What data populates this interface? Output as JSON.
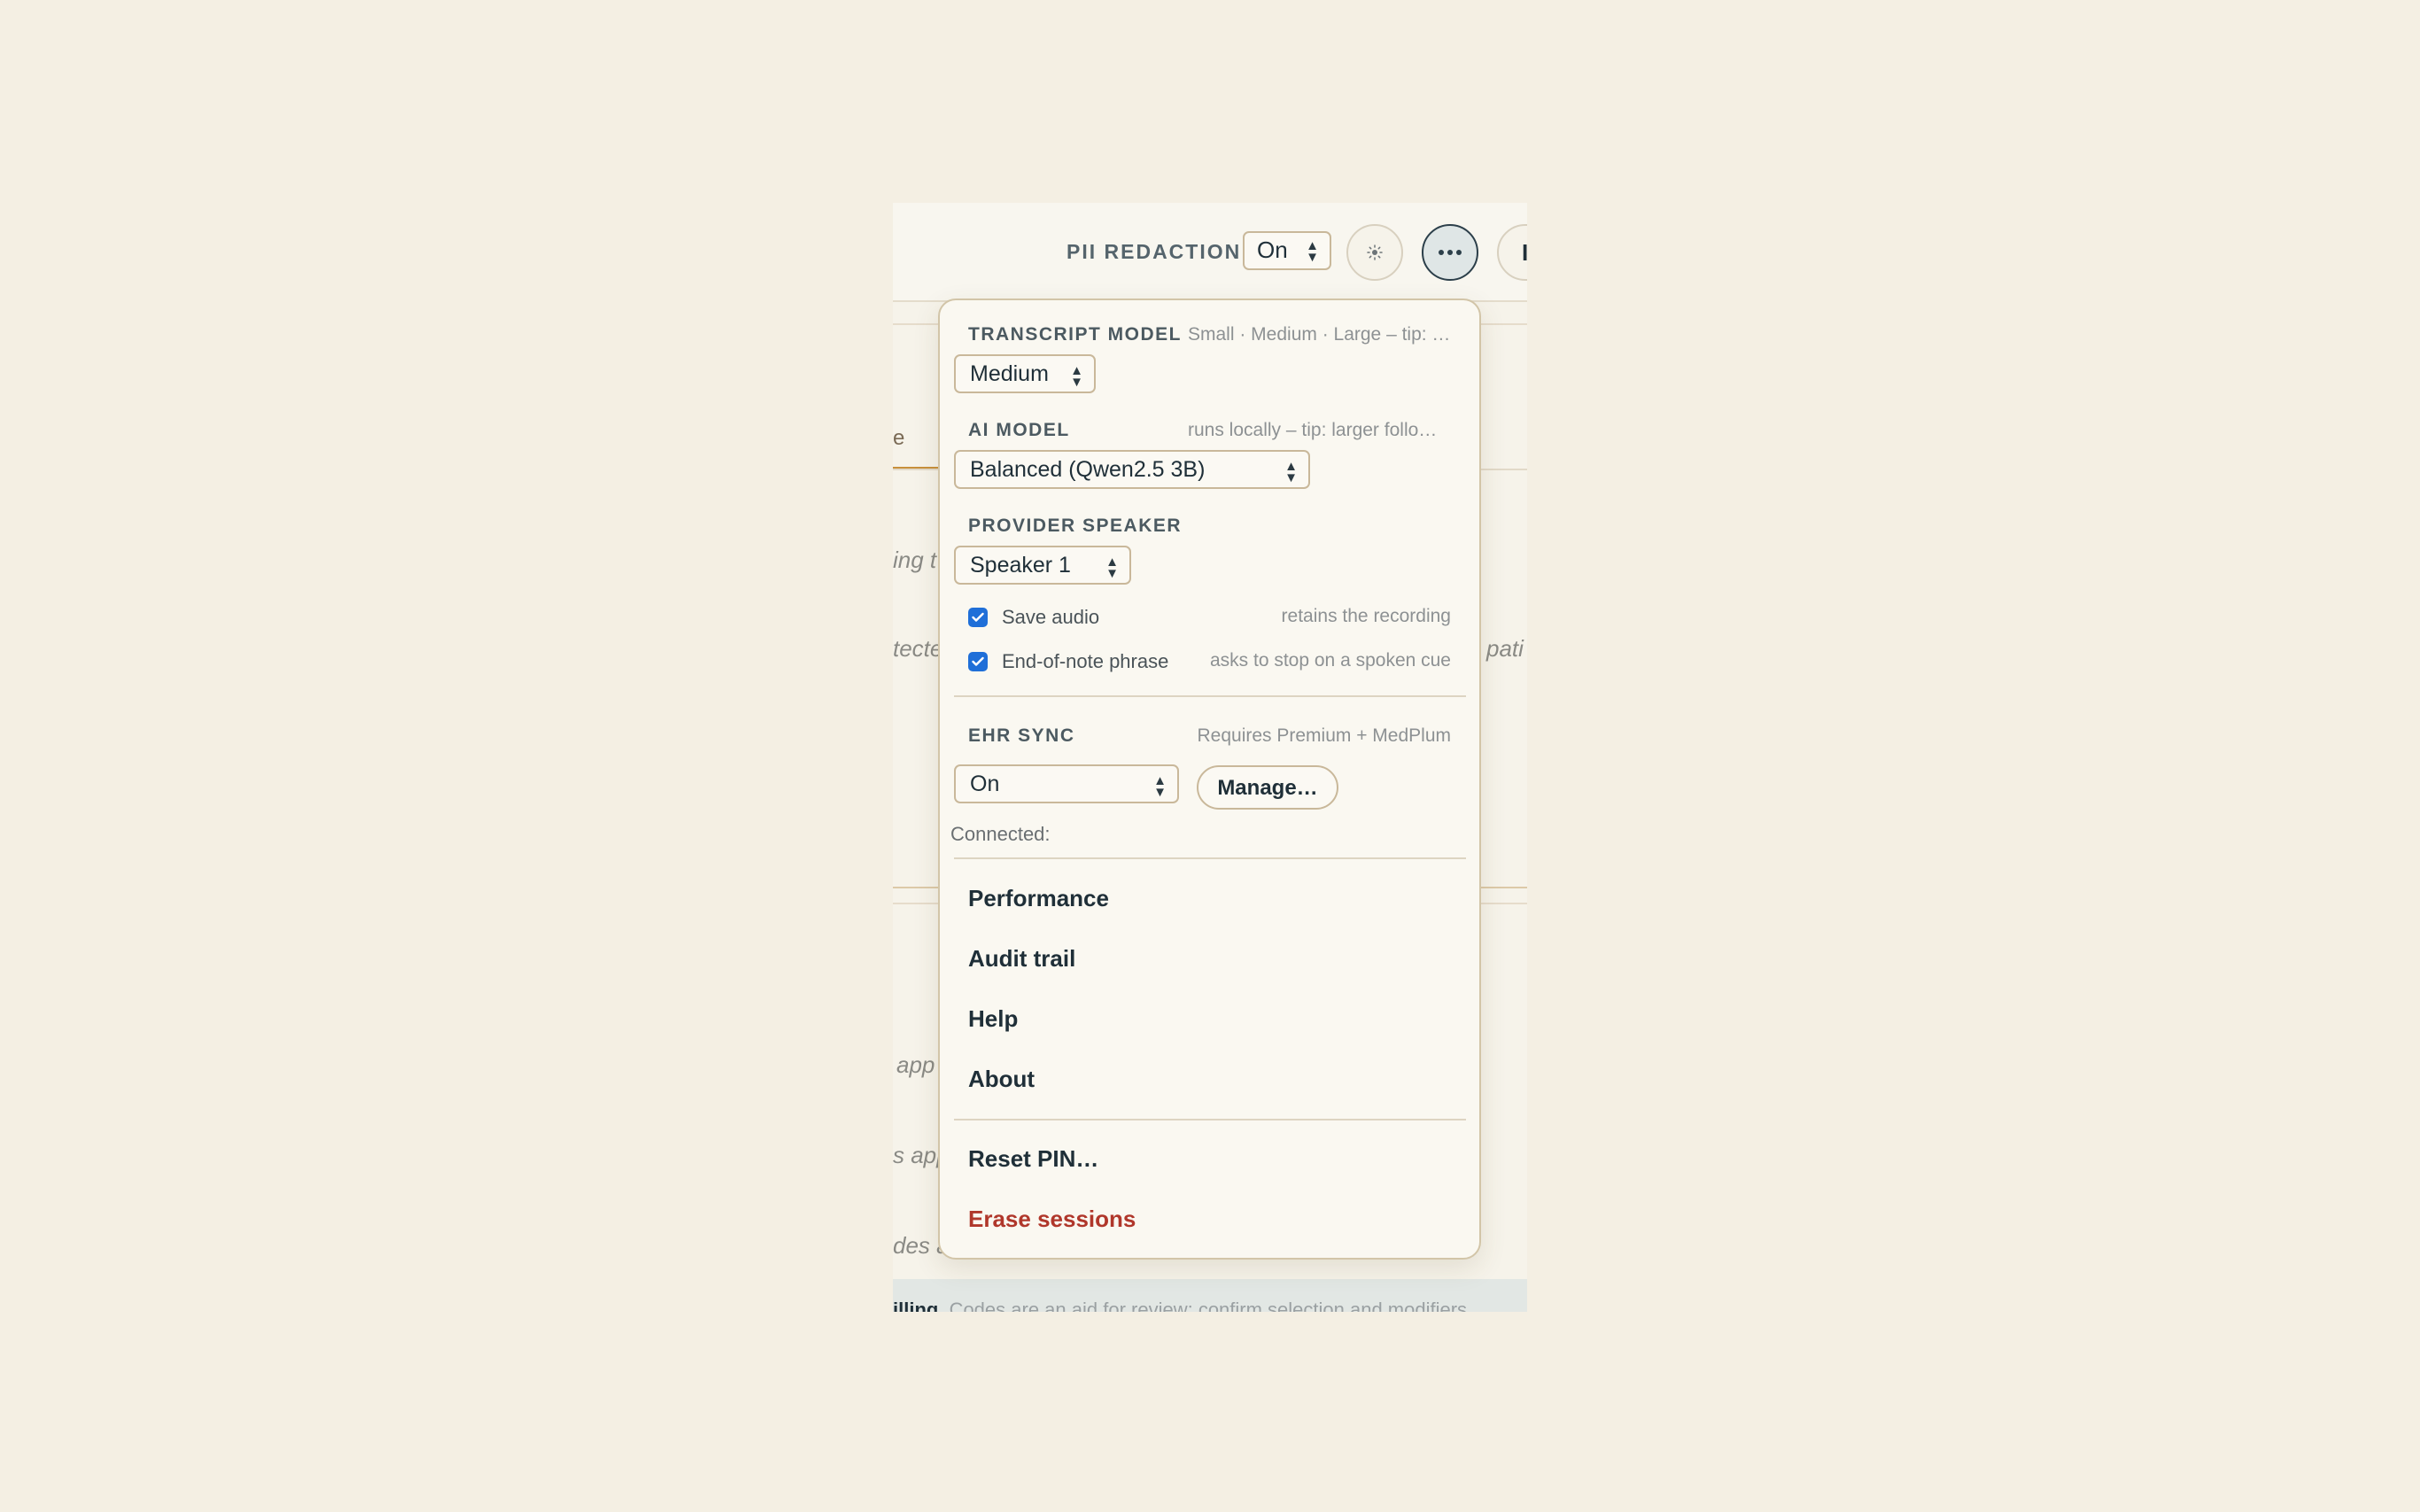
{
  "topbar": {
    "pii_label": "PII REDACTION",
    "pii_value": "On",
    "partial_button_label": "I"
  },
  "background": {
    "tab_fragment": "e",
    "text_fragments": [
      "ing t",
      "tecte",
      "pati",
      "app",
      "s app",
      "des a"
    ],
    "billing_bold": "illing",
    "billing_text": "Codes are an aid for review; confirm selection and modifiers"
  },
  "panel": {
    "transcript_model": {
      "label": "TRANSCRIPT MODEL",
      "hint": "Small · Medium · Large – tip: …",
      "value": "Medium"
    },
    "ai_model": {
      "label": "AI MODEL",
      "hint": "runs locally – tip: larger follo…",
      "value": "Balanced (Qwen2.5 3B)"
    },
    "provider_speaker": {
      "label": "PROVIDER SPEAKER",
      "value": "Speaker 1"
    },
    "save_audio": {
      "label": "Save audio",
      "hint": "retains the recording",
      "checked": true
    },
    "end_phrase": {
      "label": "End-of-note phrase",
      "hint": "asks to stop on a spoken cue",
      "checked": true
    },
    "ehr_sync": {
      "label": "EHR SYNC",
      "hint": "Requires Premium + MedPlum",
      "value": "On",
      "manage_label": "Manage…",
      "connected_label": "Connected:"
    },
    "menu": {
      "performance": "Performance",
      "audit_trail": "Audit trail",
      "help": "Help",
      "about": "About",
      "reset_pin": "Reset PIN…",
      "erase_sessions": "Erase sessions"
    }
  },
  "colors": {
    "accent_check": "#1f6fd8",
    "danger": "#b0372b",
    "tab_accent": "#c8903c"
  },
  "icons": {
    "theme": "sun-icon",
    "more": "more-dots-icon",
    "select": "updown-chevron-icon",
    "check": "checkmark-icon"
  }
}
